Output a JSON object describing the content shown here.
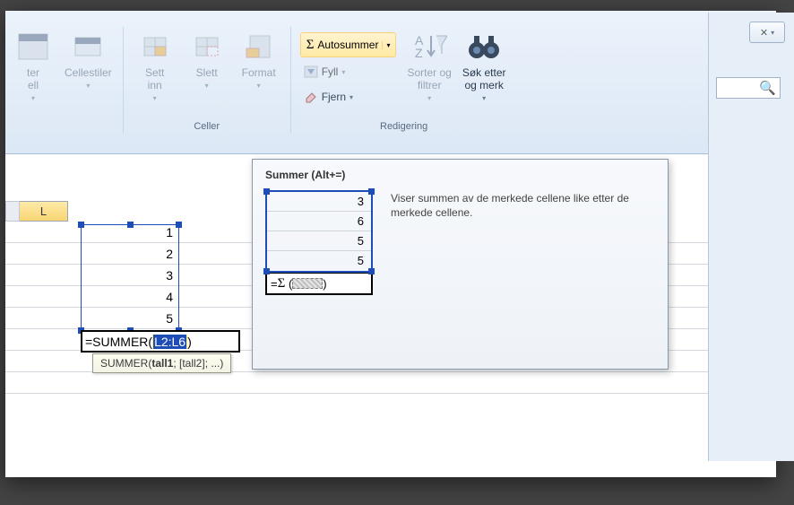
{
  "ribbon": {
    "styles": {
      "ter_label": "ter",
      "ell_label": "ell",
      "cellestiler": "Cellestiler"
    },
    "celler": {
      "group": "Celler",
      "sett_inn": "Sett\ninn",
      "slett": "Slett",
      "format": "Format"
    },
    "redigering": {
      "group": "Redigering",
      "autosum": "Autosummer",
      "fyll": "Fyll",
      "fjern": "Fjern",
      "sorter": "Sorter og\nfiltrer",
      "sok": "Søk etter\nog merk"
    }
  },
  "sheet": {
    "col": "L",
    "values": [
      "1",
      "2",
      "3",
      "4",
      "5"
    ],
    "formula_prefix": "=SUMMER(",
    "formula_range": "L2:L6",
    "formula_suffix": ")",
    "sig_fn": "SUMMER(",
    "sig_arg1": "tall1",
    "sig_rest": "; [tall2]; ...)"
  },
  "tooltip": {
    "title": "Summer (Alt+=)",
    "thumb_values": [
      "3",
      "6",
      "5",
      "5"
    ],
    "thumb_formula_pre": "=",
    "thumb_formula_suf": "(           )",
    "desc": "Viser summen av de merkede cellene like etter de merkede cellene."
  },
  "mini": {
    "close": "✕"
  }
}
